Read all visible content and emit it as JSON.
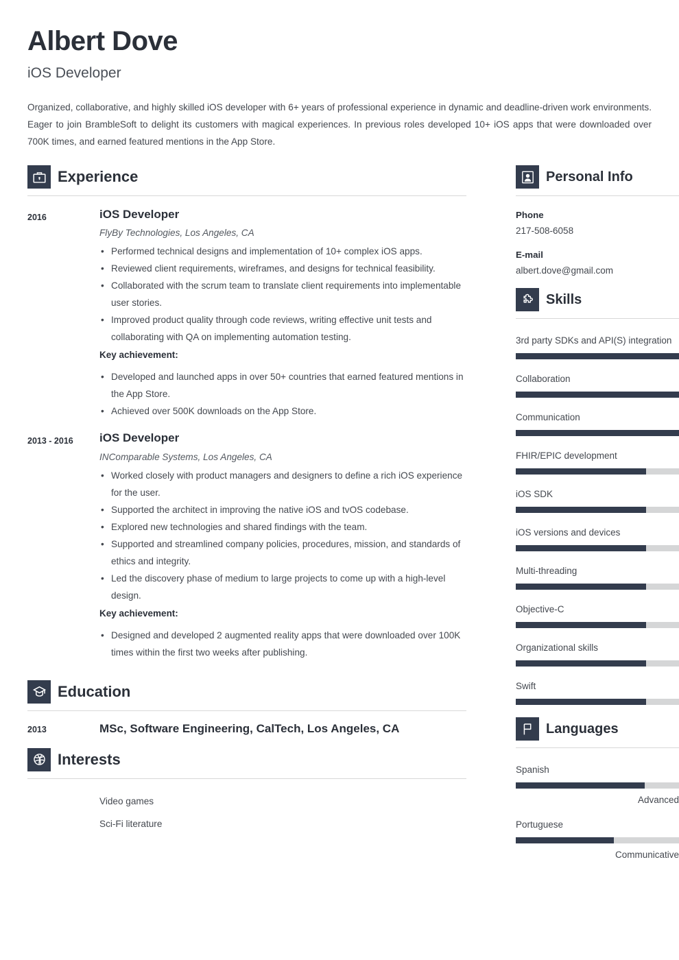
{
  "header": {
    "name": "Albert Dove",
    "job_title": "iOS Developer",
    "summary": "Organized, collaborative, and highly skilled iOS developer with 6+ years of professional experience in dynamic and deadline-driven work environments. Eager to join BrambleSoft to delight its customers with magical experiences. In previous roles developed 10+ iOS apps that were downloaded over 700K times, and earned featured mentions in the App Store."
  },
  "sections": {
    "experience_title": "Experience",
    "education_title": "Education",
    "interests_title": "Interests",
    "personal_info_title": "Personal Info",
    "skills_title": "Skills",
    "languages_title": "Languages"
  },
  "experience": [
    {
      "date": "2016",
      "role": "iOS Developer",
      "company": "FlyBy Technologies, Los Angeles, CA",
      "bullets": [
        "Performed technical designs and implementation of 10+ complex iOS apps.",
        "Reviewed client requirements, wireframes, and designs for technical feasibility.",
        "Collaborated with the scrum team to translate client requirements into implementable user stories.",
        "Improved product quality through code reviews, writing effective unit tests and collaborating with QA on implementing automation testing."
      ],
      "key_achievement_label": "Key achievement:",
      "achievements": [
        "Developed and launched apps in over 50+ countries that earned featured mentions in the App Store.",
        "Achieved over 500K downloads on the App Store."
      ]
    },
    {
      "date": "2013 - 2016",
      "role": "iOS Developer",
      "company": "INComparable Systems, Los Angeles, CA",
      "bullets": [
        "Worked closely with product managers and designers to define a rich iOS experience for the user.",
        "Supported the architect in improving the native iOS and tvOS codebase.",
        "Explored new technologies and shared findings with the team.",
        "Supported and streamlined company policies, procedures, mission, and standards of ethics and integrity.",
        "Led the discovery phase of medium to large projects to come up with a high-level design."
      ],
      "key_achievement_label": "Key achievement:",
      "achievements": [
        "Designed and developed 2 augmented reality apps that were downloaded over 100K times within the first two weeks after publishing."
      ]
    }
  ],
  "education": [
    {
      "date": "2013",
      "text": "MSc, Software Engineering,  CalTech, Los Angeles, CA"
    }
  ],
  "interests": [
    "Video games",
    "Sci-Fi literature"
  ],
  "personal_info": [
    {
      "label": "Phone",
      "value": "217-508-6058"
    },
    {
      "label": "E-mail",
      "value": "albert.dove@gmail.com"
    }
  ],
  "skills": [
    {
      "name": "3rd party SDKs and API(S) integration",
      "level": 100
    },
    {
      "name": "Collaboration",
      "level": 100
    },
    {
      "name": "Communication",
      "level": 100
    },
    {
      "name": "FHIR/EPIC development",
      "level": 80
    },
    {
      "name": "iOS SDK",
      "level": 80
    },
    {
      "name": "iOS versions and devices",
      "level": 80
    },
    {
      "name": "Multi-threading",
      "level": 80
    },
    {
      "name": "Objective-C",
      "level": 80
    },
    {
      "name": "Organizational skills",
      "level": 80
    },
    {
      "name": "Swift",
      "level": 80
    }
  ],
  "languages": [
    {
      "name": "Spanish",
      "level": 79,
      "level_label": "Advanced"
    },
    {
      "name": "Portuguese",
      "level": 60,
      "level_label": "Communicative"
    }
  ],
  "colors": {
    "accent_dark": "#333c4d",
    "heading": "#2b3039",
    "body_text": "#44484f",
    "bar_track": "#d5d6d7",
    "rule": "#d8d8d8"
  }
}
